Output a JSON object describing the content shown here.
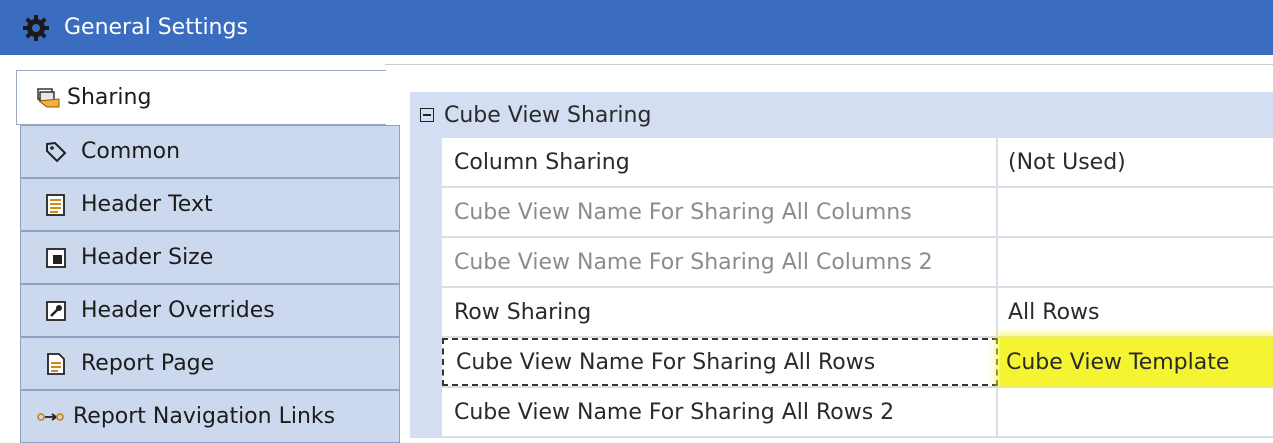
{
  "titlebar": {
    "title": "General Settings",
    "icon": "gear-icon"
  },
  "tabs": [
    {
      "label": "Sharing",
      "icon": "folder-share-icon",
      "active": true
    },
    {
      "label": "Common",
      "icon": "tag-icon"
    },
    {
      "label": "Header Text",
      "icon": "text-doc-icon"
    },
    {
      "label": "Header Size",
      "icon": "resize-icon"
    },
    {
      "label": "Header Overrides",
      "icon": "wrench-icon"
    },
    {
      "label": "Report Page",
      "icon": "page-icon"
    },
    {
      "label": "Report Navigation Links",
      "icon": "nav-links-icon"
    }
  ],
  "grid": {
    "section": "Cube View Sharing",
    "rows": [
      {
        "name": "Column Sharing",
        "value": "(Not Used)"
      },
      {
        "name": "Cube View Name For Sharing All Columns",
        "value": ""
      },
      {
        "name": "Cube View Name For Sharing All Columns 2",
        "value": ""
      },
      {
        "name": "Row Sharing",
        "value": "All Rows"
      },
      {
        "name": "Cube View Name For Sharing All Rows",
        "value": "Cube View Template"
      },
      {
        "name": "Cube View Name For Sharing All Rows 2",
        "value": ""
      }
    ]
  },
  "colors": {
    "titlebar": "#3a6dbf",
    "tab_bg": "#ccd8ee",
    "grid_bg": "#d3def3",
    "highlight": "#f4f432"
  }
}
